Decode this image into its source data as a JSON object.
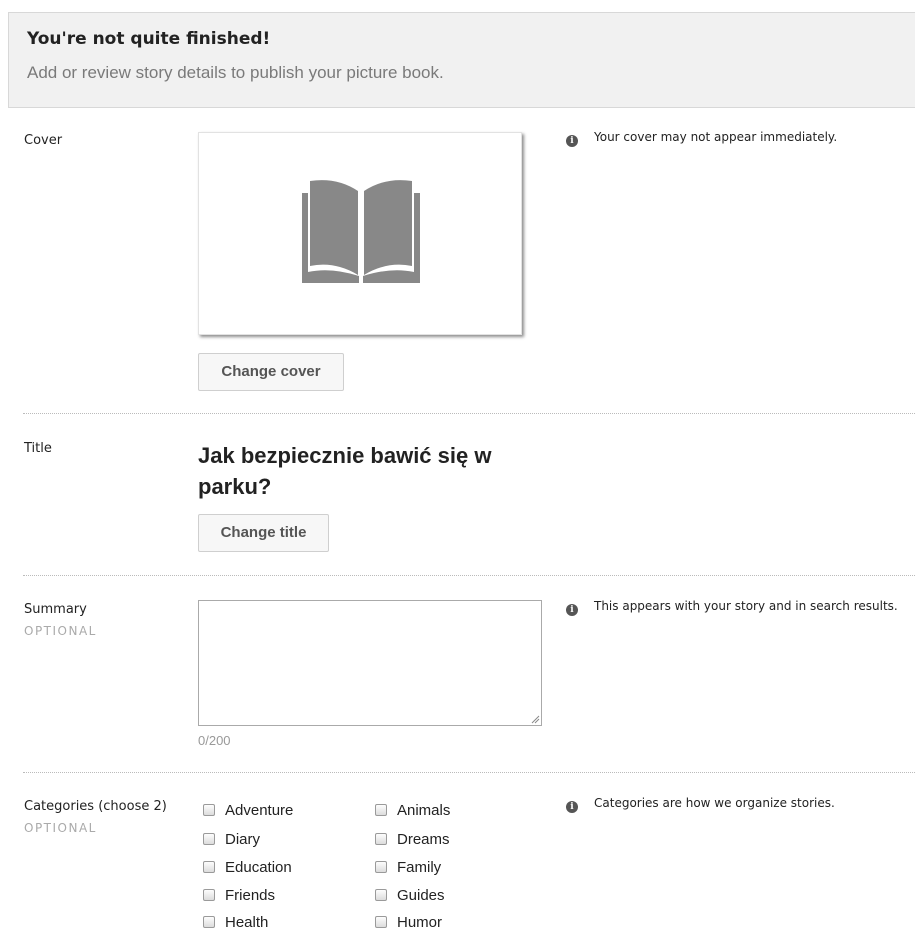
{
  "banner": {
    "title": "You're not quite finished!",
    "subtitle": "Add or review story details to publish your picture book."
  },
  "cover": {
    "label": "Cover",
    "info": "Your cover may not appear immediately.",
    "change_button": "Change cover",
    "placeholder_icon": "open-book-icon"
  },
  "title_section": {
    "label": "Title",
    "value": "Jak bezpiecznie bawić się w parku?",
    "change_button": "Change title"
  },
  "summary": {
    "label": "Summary",
    "optional": "OPTIONAL",
    "info": "This appears with your story and in search results.",
    "value": "",
    "counter": "0/200"
  },
  "categories": {
    "label": "Categories (choose 2)",
    "optional": "OPTIONAL",
    "info": "Categories are how we organize stories.",
    "items": [
      {
        "label": "Adventure",
        "checked": false
      },
      {
        "label": "Animals",
        "checked": false
      },
      {
        "label": "Diary",
        "checked": false
      },
      {
        "label": "Dreams",
        "checked": false
      },
      {
        "label": "Education",
        "checked": false
      },
      {
        "label": "Family",
        "checked": false
      },
      {
        "label": "Friends",
        "checked": false
      },
      {
        "label": "Guides",
        "checked": false
      },
      {
        "label": "Health",
        "checked": false
      },
      {
        "label": "Humor",
        "checked": false
      }
    ]
  },
  "colors": {
    "banner_bg": "#f1f1f1",
    "optional_text": "#aaaaaa",
    "icon_gray": "#888888"
  }
}
